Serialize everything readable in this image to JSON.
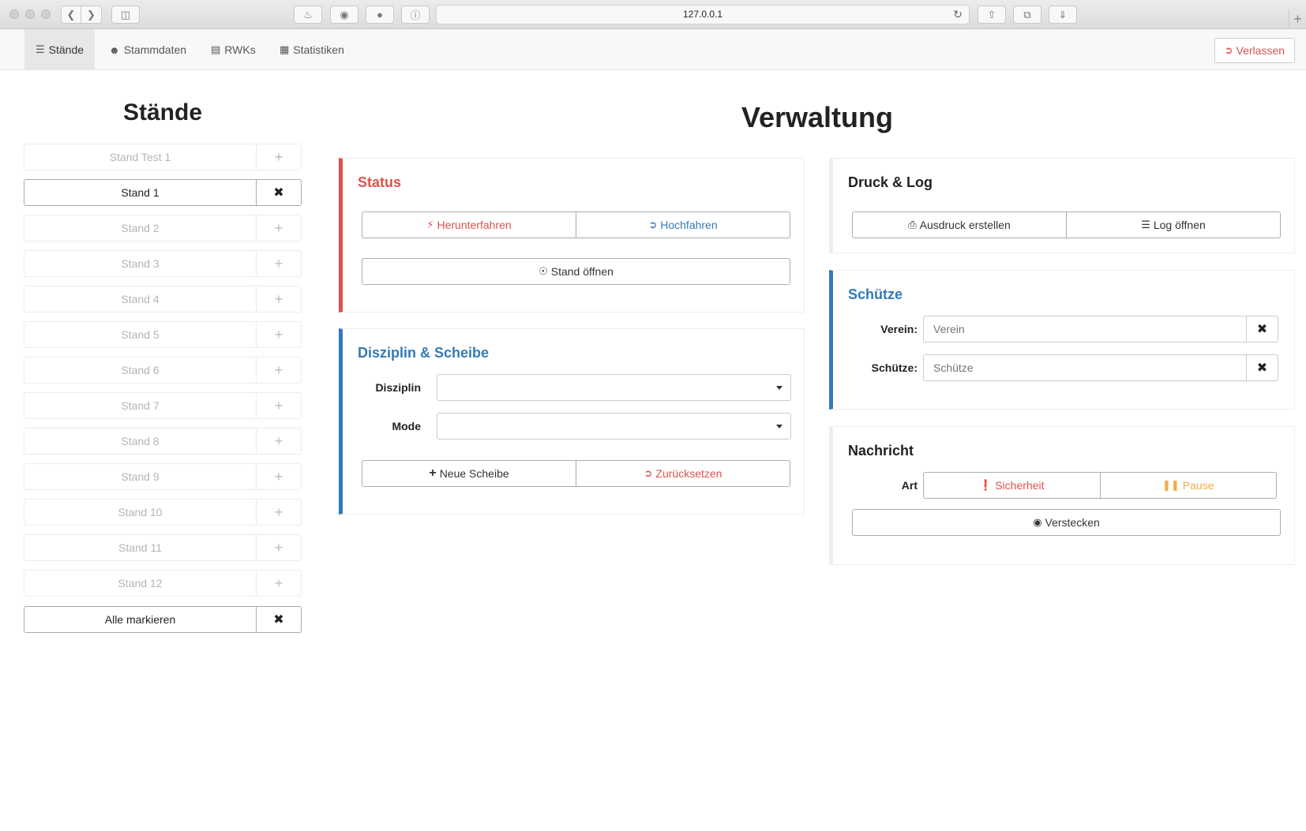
{
  "browser": {
    "url": "127.0.0.1"
  },
  "nav": {
    "items": [
      {
        "label": "Stände",
        "icon": "list-icon",
        "active": true
      },
      {
        "label": "Stammdaten",
        "icon": "user-icon",
        "active": false
      },
      {
        "label": "RWKs",
        "icon": "document-icon",
        "active": false
      },
      {
        "label": "Statistiken",
        "icon": "bar-chart-icon",
        "active": false
      }
    ],
    "leave_label": "Verlassen"
  },
  "stands": {
    "title": "Stände",
    "items": [
      {
        "label": "Stand Test 1",
        "selected": false,
        "action": "+"
      },
      {
        "label": "Stand 1",
        "selected": true,
        "action": "✖"
      },
      {
        "label": "Stand 2",
        "selected": false,
        "action": "+"
      },
      {
        "label": "Stand 3",
        "selected": false,
        "action": "+"
      },
      {
        "label": "Stand 4",
        "selected": false,
        "action": "+"
      },
      {
        "label": "Stand 5",
        "selected": false,
        "action": "+"
      },
      {
        "label": "Stand 6",
        "selected": false,
        "action": "+"
      },
      {
        "label": "Stand 7",
        "selected": false,
        "action": "+"
      },
      {
        "label": "Stand 8",
        "selected": false,
        "action": "+"
      },
      {
        "label": "Stand 9",
        "selected": false,
        "action": "+"
      },
      {
        "label": "Stand 10",
        "selected": false,
        "action": "+"
      },
      {
        "label": "Stand 11",
        "selected": false,
        "action": "+"
      },
      {
        "label": "Stand 12",
        "selected": false,
        "action": "+"
      },
      {
        "label": "Alle markieren",
        "selected": true,
        "action": "✖"
      }
    ]
  },
  "main": {
    "title": "Verwaltung"
  },
  "status": {
    "title": "Status",
    "shutdown_label": "Herunterfahren",
    "startup_label": "Hochfahren",
    "open_label": "Stand öffnen"
  },
  "disziplin": {
    "title": "Disziplin & Scheibe",
    "disziplin_label": "Disziplin",
    "disziplin_value": "",
    "mode_label": "Mode",
    "mode_value": "",
    "new_target_label": "Neue Scheibe",
    "reset_label": "Zurücksetzen"
  },
  "druck": {
    "title": "Druck & Log",
    "print_label": "Ausdruck erstellen",
    "log_label": "Log öffnen"
  },
  "schuetze": {
    "title": "Schütze",
    "verein_label": "Verein:",
    "verein_value": "",
    "verein_placeholder": "Verein",
    "schuetze_label": "Schütze:",
    "schuetze_value": "",
    "schuetze_placeholder": "Schütze"
  },
  "nachricht": {
    "title": "Nachricht",
    "art_label": "Art",
    "security_label": "Sicherheit",
    "pause_label": "Pause",
    "hide_label": "Verstecken"
  },
  "colors": {
    "danger": "#d9534f",
    "primary": "#337ab7",
    "warning": "#f0ad4e"
  }
}
